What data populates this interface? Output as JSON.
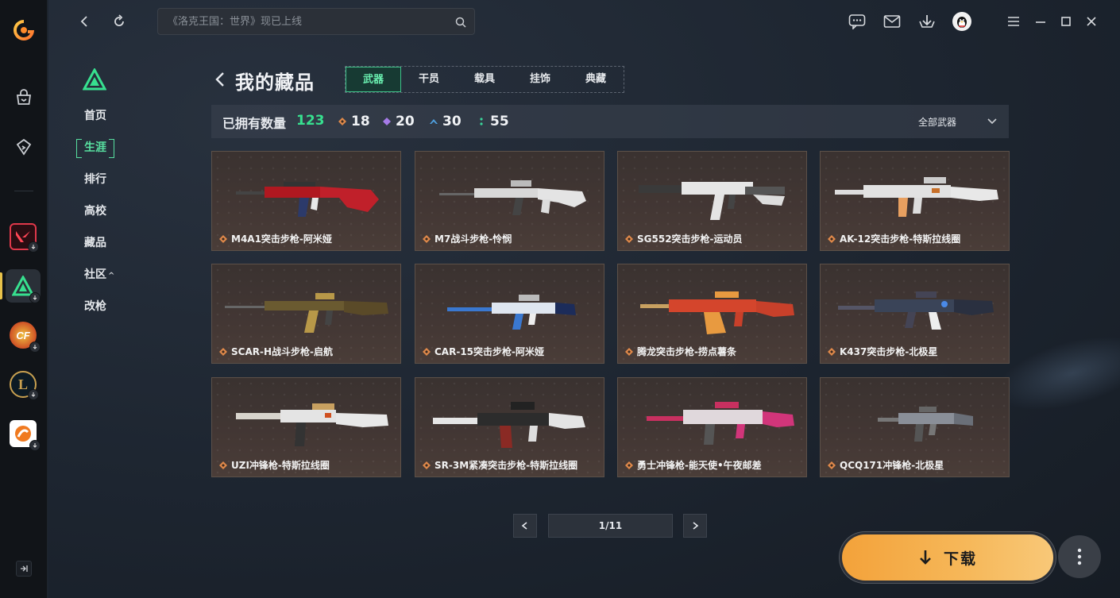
{
  "search": {
    "placeholder": "《洛克王国：世界》现已上线"
  },
  "side_nav": {
    "items": [
      {
        "label": "首页",
        "active": false
      },
      {
        "label": "生涯",
        "active": true
      },
      {
        "label": "排行",
        "active": false
      },
      {
        "label": "高校",
        "active": false
      },
      {
        "label": "藏品",
        "active": false
      },
      {
        "label": "社区",
        "active": false,
        "caret": "^"
      },
      {
        "label": "改枪",
        "active": false
      }
    ]
  },
  "page": {
    "title": "我的藏品",
    "tabs": [
      {
        "label": "武器",
        "active": true
      },
      {
        "label": "干员",
        "active": false
      },
      {
        "label": "载具",
        "active": false
      },
      {
        "label": "挂饰",
        "active": false
      },
      {
        "label": "典藏",
        "active": false
      }
    ]
  },
  "stats": {
    "owned_label": "已拥有数量",
    "owned_total": "123",
    "items": [
      {
        "value": "18",
        "color": "#e0894a",
        "icon": "diamond-orange-icon"
      },
      {
        "value": "20",
        "color": "#a67be8",
        "icon": "diamond-purple-icon"
      },
      {
        "value": "30",
        "color": "#4fa0e0",
        "icon": "chevron-blue-icon"
      },
      {
        "value": "55",
        "color": "#3ad69a",
        "icon": "dots-green-icon"
      }
    ],
    "filter_label": "全部武器"
  },
  "weapons": [
    {
      "name": "M4A1突击步枪-阿米娅",
      "accent": "#c0202a"
    },
    {
      "name": "M7战斗步枪-怜悯",
      "accent": "#d8d8d8"
    },
    {
      "name": "SG552突击步枪-运动员",
      "accent": "#e6e6e6"
    },
    {
      "name": "AK-12突击步枪-特斯拉线圈",
      "accent": "#e2e2e2"
    },
    {
      "name": "SCAR-H战斗步枪-启航",
      "accent": "#b89848"
    },
    {
      "name": "CAR-15突击步枪-阿米娅",
      "accent": "#2a6fc6"
    },
    {
      "name": "腾龙突击步枪-捞点薯条",
      "accent": "#d4452c"
    },
    {
      "name": "K437突击步枪-北极星",
      "accent": "#4a5a78"
    },
    {
      "name": "UZI冲锋枪-特斯拉线圈",
      "accent": "#e4e4e4"
    },
    {
      "name": "SR-3M紧凑突击步枪-特斯拉线圈",
      "accent": "#dcdcdc"
    },
    {
      "name": "勇士冲锋枪-能天使•午夜邮差",
      "accent": "#d1357a"
    },
    {
      "name": "QCQ171冲锋枪-北极星",
      "accent": "#8a8f98"
    }
  ],
  "pagination": {
    "current": "1/11"
  },
  "download": {
    "label": "下载"
  }
}
